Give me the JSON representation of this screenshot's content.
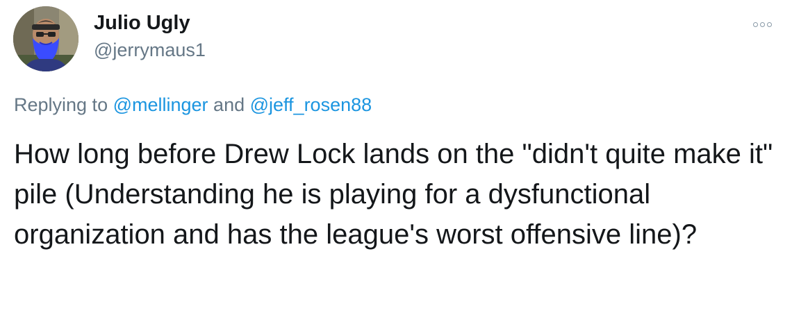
{
  "author": {
    "display_name": "Julio Ugly",
    "handle": "@jerrymaus1",
    "avatar_icon": "profile-photo-blue-beard"
  },
  "more_icon": "ellipsis-icon",
  "reply": {
    "prefix": "Replying to ",
    "mention_1": "@mellinger",
    "connector": " and ",
    "mention_2": "@jeff_rosen88"
  },
  "tweet": {
    "text": "How long before Drew Lock lands on the \"didn't quite make it\" pile (Understanding he is playing for a dysfunctional organization and has the league's worst offensive line)?"
  },
  "colors": {
    "link": "#1b95e0",
    "secondary_text": "#657786",
    "primary_text": "#14171a",
    "avatar_beard": "#3a4cff"
  }
}
